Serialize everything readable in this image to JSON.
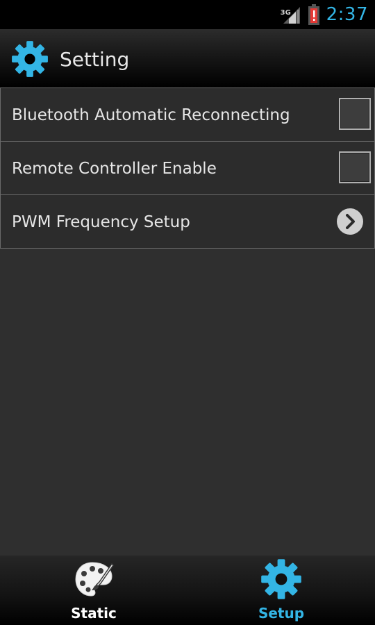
{
  "status_bar": {
    "network_type": "3G",
    "time": "2:37",
    "icons": [
      "signal-icon",
      "battery-alert-icon"
    ]
  },
  "action_bar": {
    "title": "Setting",
    "icon": "gear-icon"
  },
  "settings": [
    {
      "label": "Bluetooth Automatic Reconnecting",
      "control": "checkbox",
      "checked": false
    },
    {
      "label": "Remote Controller Enable",
      "control": "checkbox",
      "checked": false
    },
    {
      "label": "PWM Frequency Setup",
      "control": "chevron-right-icon"
    }
  ],
  "tabs": [
    {
      "label": "Static",
      "icon": "palette-icon",
      "active": false
    },
    {
      "label": "Setup",
      "icon": "gear-icon",
      "active": true
    }
  ],
  "colors": {
    "accent": "#33b5e5",
    "background": "#2f2f2f",
    "battery_alert": "#e53935"
  }
}
